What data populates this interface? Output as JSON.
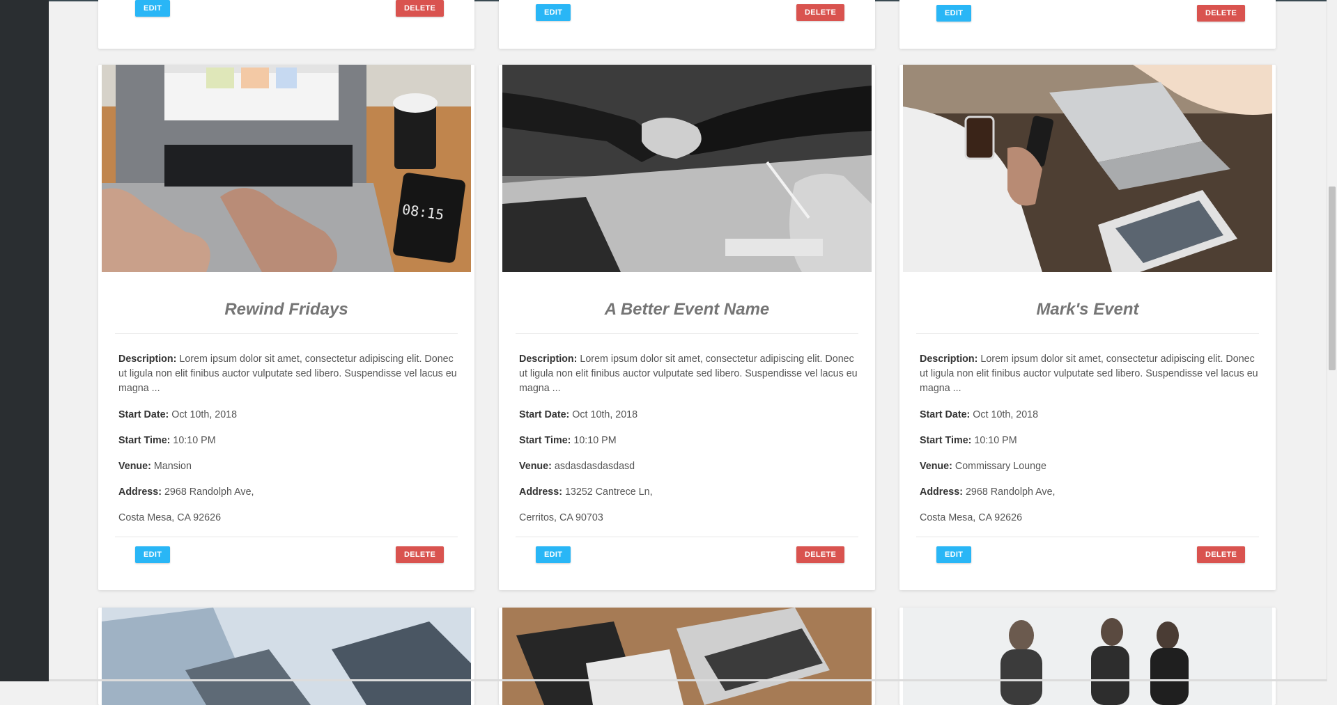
{
  "buttons": {
    "edit": "EDIT",
    "delete": "DELETE"
  },
  "labels": {
    "description": "Description:",
    "start_date": "Start Date:",
    "start_time": "Start Time:",
    "venue": "Venue:",
    "address": "Address:"
  },
  "events": [
    {
      "title": "Rewind Fridays",
      "image": "laptop-coffee-photo",
      "description": "Lorem ipsum dolor sit amet, consectetur adipiscing elit. Donec ut ligula non elit finibus auctor vulputate sed libero. Suspendisse vel lacus eu magna ...",
      "start_date": "Oct 10th, 2018",
      "start_time": "10:10 PM",
      "venue": "Mansion",
      "address_line1": "2968 Randolph Ave,",
      "address_line2": "Costa Mesa, CA 92626"
    },
    {
      "title": "A Better Event Name",
      "image": "handshake-photo",
      "description": "Lorem ipsum dolor sit amet, consectetur adipiscing elit. Donec ut ligula non elit finibus auctor vulputate sed libero. Suspendisse vel lacus eu magna ...",
      "start_date": "Oct 10th, 2018",
      "start_time": "10:10 PM",
      "venue": "asdasdasdasdasd",
      "address_line1": "13252 Cantrece Ln,",
      "address_line2": "Cerritos, CA 90703"
    },
    {
      "title": "Mark's Event",
      "image": "cafe-laptop-photo",
      "description": "Lorem ipsum dolor sit amet, consectetur adipiscing elit. Donec ut ligula non elit finibus auctor vulputate sed libero. Suspendisse vel lacus eu magna ...",
      "start_date": "Oct 10th, 2018",
      "start_time": "10:10 PM",
      "venue": "Commissary Lounge",
      "address_line1": "2968 Randolph Ave,",
      "address_line2": "Costa Mesa, CA 92626"
    }
  ],
  "colors": {
    "edit": "#29b6f6",
    "delete": "#d9534f",
    "title": "#757575"
  }
}
